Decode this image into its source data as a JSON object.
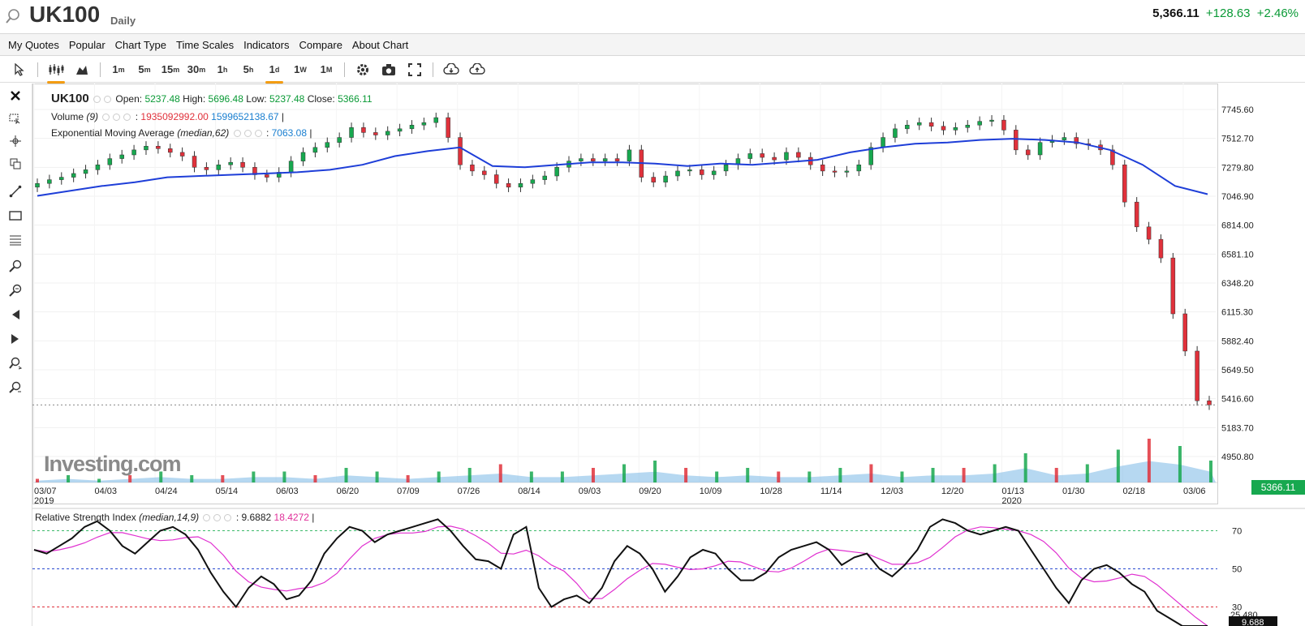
{
  "header": {
    "symbol": "UK100",
    "timeframe": "Daily",
    "price": "5,366.11",
    "change": "+128.63",
    "change_pct": "+2.46%"
  },
  "menu": [
    "My Quotes",
    "Popular",
    "Chart Type",
    "Time Scales",
    "Indicators",
    "Compare",
    "About Chart"
  ],
  "toolbar": {
    "intervals": [
      {
        "n": "1",
        "u": "m"
      },
      {
        "n": "5",
        "u": "m"
      },
      {
        "n": "15",
        "u": "m"
      },
      {
        "n": "30",
        "u": "m"
      },
      {
        "n": "1",
        "u": "h"
      },
      {
        "n": "5",
        "u": "h"
      },
      {
        "n": "1",
        "u": "d"
      },
      {
        "n": "1",
        "u": "W"
      },
      {
        "n": "1",
        "u": "M"
      }
    ],
    "active_interval": "1d"
  },
  "legend": {
    "symbol": "UK100",
    "open_label": "Open:",
    "open": "5237.48",
    "high_label": "High:",
    "high": "5696.48",
    "low_label": "Low:",
    "low": "5237.48",
    "close_label": "Close:",
    "close": "5366.11",
    "volume_label": "Volume",
    "volume_param": "(9)",
    "volume_v1": "1935092992.00",
    "volume_v2": "1599652138.67",
    "ema_label": "Exponential Moving Average",
    "ema_param": "(median,62)",
    "ema_value": "7063.08"
  },
  "rsi_legend": {
    "label": "Relative Strength Index",
    "param": "(median,14,9)",
    "v1": "9.6882",
    "v2": "18.4272"
  },
  "watermark": "Investing.com",
  "price_tag": "5366.11",
  "colors": {
    "up": "#17a84f",
    "down": "#e0313b",
    "ema": "#1e3ed8",
    "volume_area": "#7ab8e6",
    "rsi_signal": "#e030d0"
  },
  "chart_data": {
    "type": "candlestick",
    "y_ticks": [
      "7745.60",
      "7512.70",
      "7279.80",
      "7046.90",
      "6814.00",
      "6581.10",
      "6348.20",
      "6115.30",
      "5882.40",
      "5649.50",
      "5416.60",
      "5183.70",
      "4950.80"
    ],
    "ylim": [
      4950.8,
      7745.6
    ],
    "x_ticks": [
      "03/07",
      "04/03",
      "04/24",
      "05/14",
      "06/03",
      "06/20",
      "07/09",
      "07/26",
      "08/14",
      "09/03",
      "09/20",
      "10/09",
      "10/28",
      "11/14",
      "12/03",
      "12/20",
      "01/13",
      "01/30",
      "02/18",
      "03/06"
    ],
    "x_years": [
      {
        "label": "2019",
        "at": "03/07"
      },
      {
        "label": "2020",
        "at": "01/13"
      }
    ],
    "close_series_approx": [
      7150,
      7180,
      7200,
      7230,
      7260,
      7300,
      7350,
      7380,
      7420,
      7450,
      7430,
      7400,
      7370,
      7280,
      7260,
      7300,
      7320,
      7280,
      7220,
      7200,
      7240,
      7330,
      7400,
      7440,
      7480,
      7520,
      7600,
      7560,
      7540,
      7570,
      7590,
      7620,
      7640,
      7680,
      7520,
      7300,
      7250,
      7220,
      7150,
      7120,
      7150,
      7180,
      7210,
      7280,
      7330,
      7350,
      7330,
      7350,
      7330,
      7420,
      7200,
      7160,
      7210,
      7250,
      7260,
      7220,
      7250,
      7300,
      7350,
      7390,
      7360,
      7340,
      7400,
      7360,
      7300,
      7250,
      7240,
      7250,
      7300,
      7440,
      7520,
      7590,
      7620,
      7640,
      7610,
      7580,
      7600,
      7620,
      7650,
      7660,
      7580,
      7420,
      7380,
      7480,
      7500,
      7520,
      7470,
      7460,
      7420,
      7300,
      7000,
      6800,
      6700,
      6550,
      6100,
      5800,
      5400,
      5366
    ],
    "ema_series_approx": [
      7050,
      7090,
      7130,
      7160,
      7200,
      7210,
      7220,
      7230,
      7240,
      7260,
      7300,
      7370,
      7410,
      7440,
      7290,
      7280,
      7300,
      7320,
      7320,
      7310,
      7290,
      7310,
      7300,
      7320,
      7340,
      7400,
      7440,
      7470,
      7480,
      7500,
      7510,
      7500,
      7480,
      7420,
      7300,
      7130,
      7063
    ],
    "volume_approx": [
      1,
      2,
      1,
      2,
      3,
      2,
      2,
      3,
      3,
      2,
      4,
      3,
      2,
      3,
      4,
      5,
      3,
      3,
      4,
      5,
      6,
      4,
      3,
      4,
      3,
      3,
      4,
      5,
      3,
      4,
      4,
      5,
      8,
      4,
      5,
      9,
      12,
      10,
      6
    ],
    "rsi": {
      "y_ticks": [
        "70",
        "50",
        "30"
      ],
      "levels": [
        70,
        50,
        30
      ],
      "last_values": [
        "25.480",
        "9.688"
      ],
      "rsi_approx": [
        60,
        58,
        62,
        66,
        72,
        75,
        70,
        62,
        58,
        64,
        70,
        72,
        68,
        60,
        48,
        38,
        30,
        40,
        46,
        42,
        34,
        36,
        44,
        58,
        66,
        72,
        70,
        64,
        68,
        70,
        72,
        74,
        76,
        70,
        62,
        55,
        54,
        50,
        68,
        72,
        40,
        30,
        34,
        36,
        32,
        40,
        54,
        62,
        58,
        50,
        38,
        46,
        56,
        60,
        58,
        50,
        44,
        44,
        48,
        56,
        60,
        62,
        64,
        60,
        52,
        56,
        58,
        50,
        46,
        52,
        60,
        72,
        76,
        74,
        70,
        68,
        70,
        72,
        70,
        60,
        50,
        40,
        32,
        44,
        50,
        52,
        48,
        42,
        38,
        28,
        24,
        20,
        14,
        9
      ]
    }
  }
}
